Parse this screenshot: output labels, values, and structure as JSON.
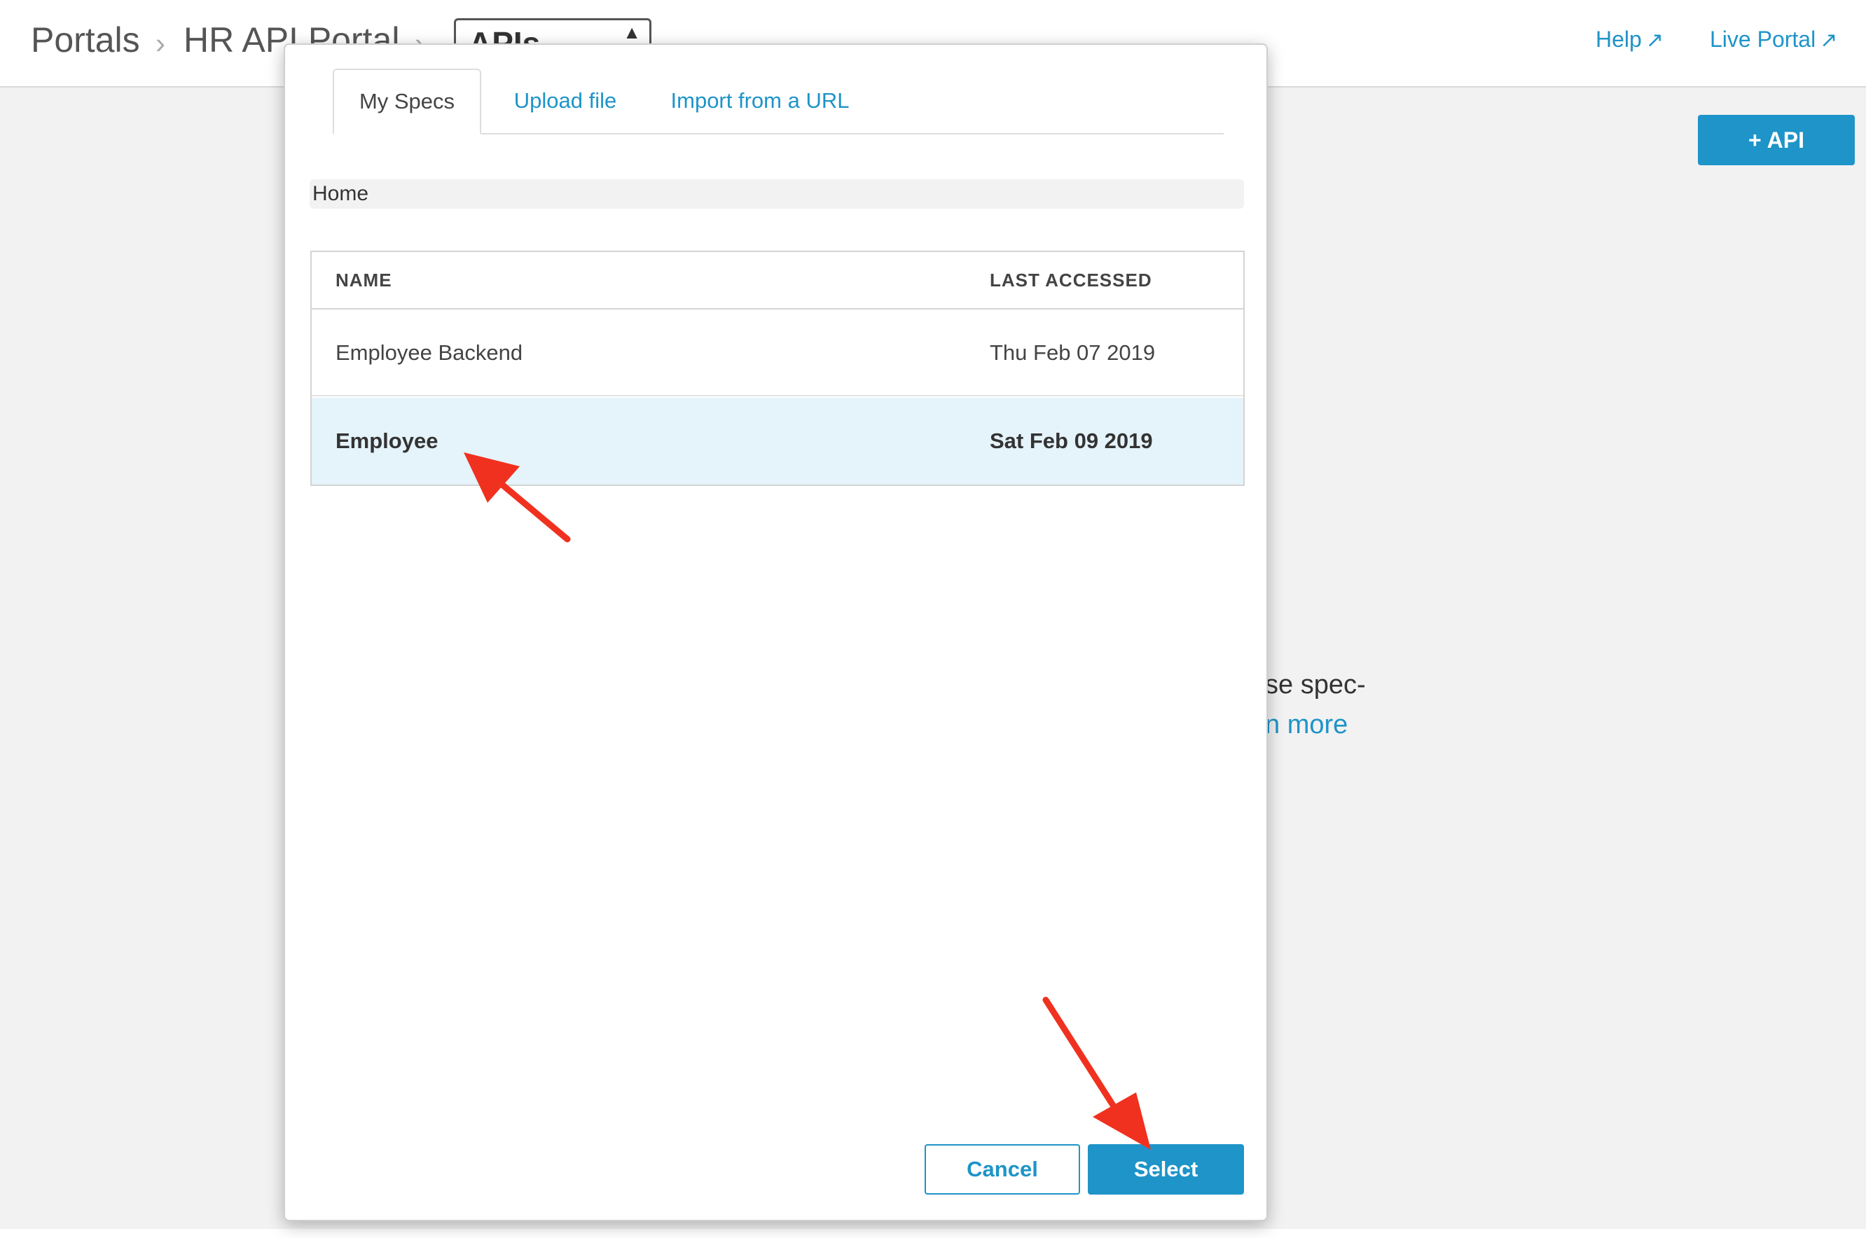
{
  "breadcrumb": {
    "portals": "Portals",
    "separator": "›",
    "portal": "HR API Portal",
    "section": "APIs",
    "section_caret": "▲"
  },
  "toplinks": {
    "help": "Help",
    "live_portal": "Live Portal",
    "external_icon": "↗"
  },
  "add_api_button": {
    "icon": "+",
    "label": "API"
  },
  "background_text": {
    "line1": "se spec-",
    "line2_link": "n more"
  },
  "modal": {
    "tabs": [
      {
        "label": "My Specs",
        "active": true
      },
      {
        "label": "Upload file",
        "active": false
      },
      {
        "label": "Import from a URL",
        "active": false
      }
    ],
    "path": "Home",
    "table": {
      "columns": [
        "NAME",
        "LAST ACCESSED"
      ],
      "rows": [
        {
          "name": "Employee Backend",
          "last_accessed": "Thu Feb 07 2019",
          "selected": false
        },
        {
          "name": "Employee",
          "last_accessed": "Sat Feb 09 2019",
          "selected": true
        }
      ]
    },
    "buttons": {
      "cancel": "Cancel",
      "select": "Select"
    }
  },
  "colors": {
    "accent": "#1e94c8",
    "selected_row": "#e5f3fa",
    "annotation_arrow": "#f0311f"
  }
}
